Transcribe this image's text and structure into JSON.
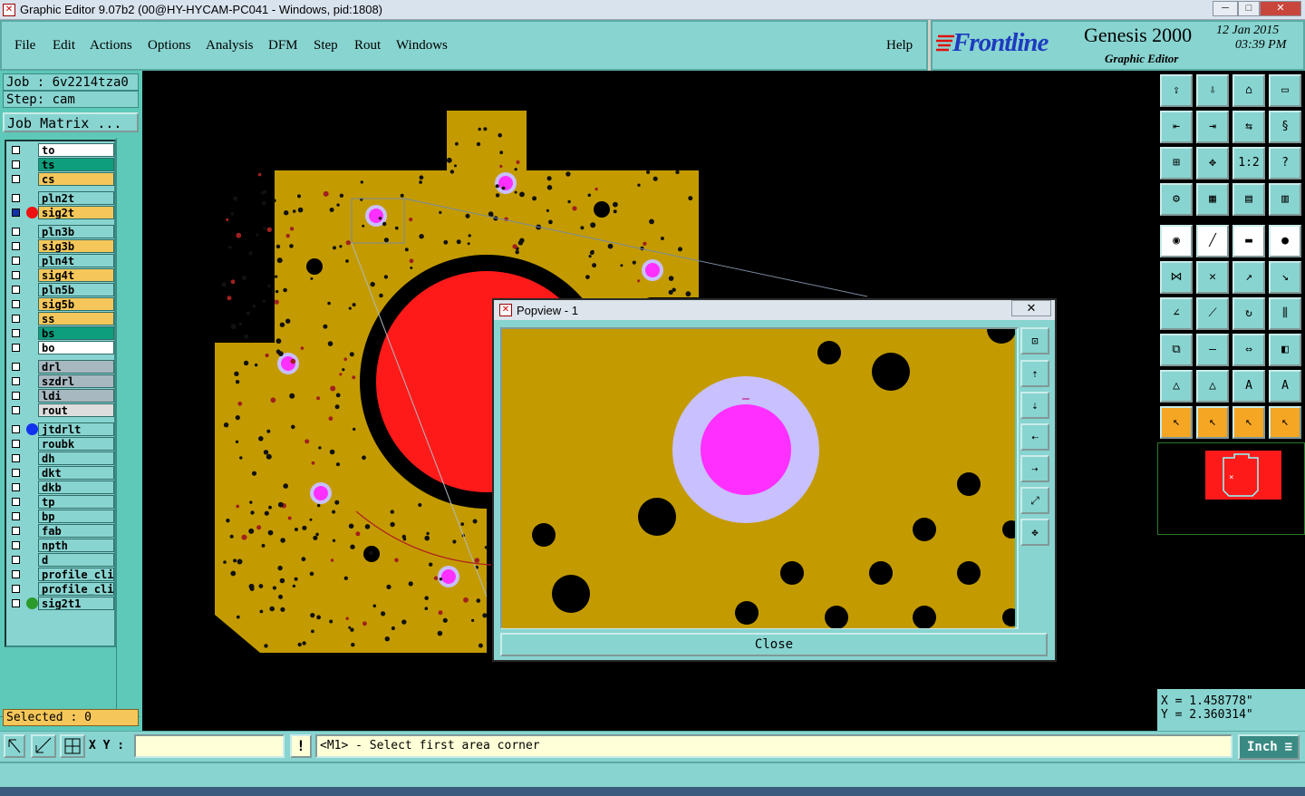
{
  "window": {
    "title": "Graphic Editor 9.07b2 (00@HY-HYCAM-PC041 - Windows, pid:1808)",
    "min": "─",
    "max": "□",
    "close": "✕"
  },
  "menu": {
    "items": [
      "File",
      "Edit",
      "Actions",
      "Options",
      "Analysis",
      "DFM",
      "Step",
      "Rout",
      "Windows"
    ],
    "help": "Help"
  },
  "brand": {
    "logo": "Frontline",
    "product": "Genesis 2000",
    "subtitle": "Graphic Editor",
    "date": "12 Jan 2015",
    "time": "03:39 PM"
  },
  "job": {
    "job_label": "Job : 6v2214tza0",
    "step_label": "Step: cam",
    "matrix_button": "Job Matrix ..."
  },
  "layers": [
    {
      "name": "to",
      "color": "#ffffff",
      "dot": ""
    },
    {
      "name": "ts",
      "color": "#0e9e7e",
      "dot": ""
    },
    {
      "name": "cs",
      "color": "#f5c75a",
      "dot": ""
    },
    {
      "name": "pln2t",
      "color": "#88d4d0",
      "dot": ""
    },
    {
      "name": "sig2t",
      "color": "#f5c75a",
      "dot": "#ee1111",
      "active": true
    },
    {
      "name": "pln3b",
      "color": "#88d4d0",
      "dot": ""
    },
    {
      "name": "sig3b",
      "color": "#f5c75a",
      "dot": ""
    },
    {
      "name": "pln4t",
      "color": "#88d4d0",
      "dot": ""
    },
    {
      "name": "sig4t",
      "color": "#f5c75a",
      "dot": ""
    },
    {
      "name": "pln5b",
      "color": "#88d4d0",
      "dot": ""
    },
    {
      "name": "sig5b",
      "color": "#f5c75a",
      "dot": ""
    },
    {
      "name": "ss",
      "color": "#f5c75a",
      "dot": ""
    },
    {
      "name": "bs",
      "color": "#0e9e7e",
      "dot": ""
    },
    {
      "name": "bo",
      "color": "#ffffff",
      "dot": ""
    },
    {
      "name": "drl",
      "color": "#a8b8c0",
      "dot": ""
    },
    {
      "name": "szdrl",
      "color": "#a8b8c0",
      "dot": ""
    },
    {
      "name": "ldi",
      "color": "#a8b8c0",
      "dot": ""
    },
    {
      "name": "rout",
      "color": "#dddddd",
      "dot": ""
    },
    {
      "name": "jtdrlt",
      "color": "#88d4d0",
      "dot": "#1133ee"
    },
    {
      "name": "roubk",
      "color": "#88d4d0",
      "dot": ""
    },
    {
      "name": "dh",
      "color": "#88d4d0",
      "dot": ""
    },
    {
      "name": "dkt",
      "color": "#88d4d0",
      "dot": ""
    },
    {
      "name": "dkb",
      "color": "#88d4d0",
      "dot": ""
    },
    {
      "name": "tp",
      "color": "#88d4d0",
      "dot": ""
    },
    {
      "name": "bp",
      "color": "#88d4d0",
      "dot": ""
    },
    {
      "name": "fab",
      "color": "#88d4d0",
      "dot": ""
    },
    {
      "name": "npth",
      "color": "#88d4d0",
      "dot": ""
    },
    {
      "name": "d",
      "color": "#88d4d0",
      "dot": ""
    },
    {
      "name": "profile_cli",
      "color": "#88d4d0",
      "dot": ""
    },
    {
      "name": "profile_cli",
      "color": "#88d4d0",
      "dot": ""
    },
    {
      "name": "sig2t1",
      "color": "#88d4d0",
      "dot": "#2a9a2a"
    }
  ],
  "selected": "Selected : 0",
  "popup": {
    "title": "Popview - 1",
    "close_label": "Close",
    "x_glyph": "✕"
  },
  "status": {
    "xy_label": "X Y :",
    "xy_value": "",
    "prompt": "<M1> - Select first area corner",
    "units": "Inch",
    "warn": "!"
  },
  "coords": {
    "x": "X = 1.458778\"",
    "y": "Y = 2.360314\""
  },
  "toolbar_icons": [
    "zoom-home-icon",
    "zoom-in-icon",
    "home-icon",
    "panel-icon",
    "pan-left-icon",
    "pan-right-icon",
    "ratio-icon",
    "snap-icon",
    "fit-icon",
    "center-icon",
    "one-to-two-icon",
    "help-icon",
    "wrench-icon",
    "grid-icon",
    "layers-icon",
    "layers-alt-icon",
    "pad-icon",
    "line-icon",
    "ruler-icon",
    "circle-icon",
    "connect-icon",
    "cross-icon",
    "arrow-icon",
    "move-icon",
    "angle-icon",
    "slope-icon",
    "rotate-icon",
    "mirror-icon",
    "copy-icon",
    "minus-icon",
    "flip-icon",
    "shapes-icon",
    "triangle-icon",
    "triangle-up-icon",
    "triangle-a-icon",
    "triangle-b-icon",
    "pointer-icon",
    "select-icon",
    "select-alt-icon",
    "route-icon"
  ],
  "colors": {
    "accent": "#88d4d0",
    "board": "#c39b00",
    "pad": "#ff30ff",
    "pad_ring": "#c8c0ff",
    "red_area": "#ff1a1a"
  }
}
